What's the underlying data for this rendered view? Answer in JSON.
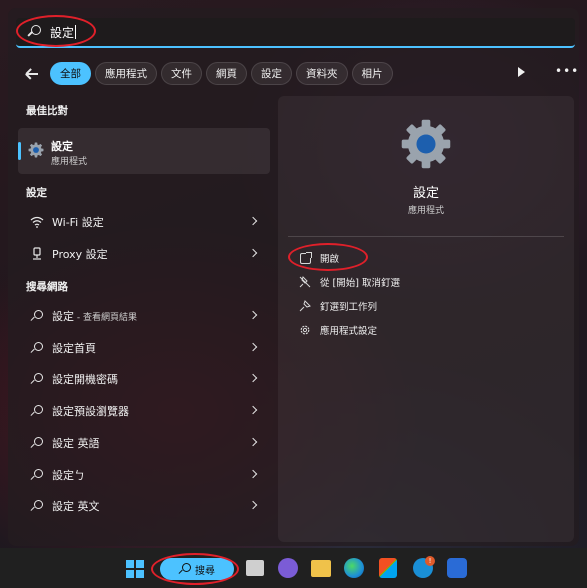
{
  "search": {
    "query": "設定"
  },
  "filters": {
    "chips": [
      "全部",
      "應用程式",
      "文件",
      "網頁",
      "設定",
      "資料夾",
      "相片"
    ],
    "active_index": 0
  },
  "best_match": {
    "heading": "最佳比對",
    "name": "設定",
    "type": "應用程式"
  },
  "settings_section": {
    "heading": "設定",
    "items": [
      {
        "label": "Wi-Fi 設定",
        "icon": "wifi-icon"
      },
      {
        "label": "Proxy 設定",
        "icon": "proxy-icon"
      }
    ]
  },
  "web_section": {
    "heading": "搜尋網路",
    "items": [
      {
        "label": "設定",
        "suffix": " - 查看網頁結果"
      },
      {
        "label": "設定首頁",
        "suffix": ""
      },
      {
        "label": "設定開機密碼",
        "suffix": ""
      },
      {
        "label": "設定預設瀏覽器",
        "suffix": ""
      },
      {
        "label": "設定 英語",
        "suffix": ""
      },
      {
        "label": "設定ㄅ",
        "suffix": ""
      },
      {
        "label": "設定 英文",
        "suffix": ""
      }
    ]
  },
  "detail": {
    "name": "設定",
    "type": "應用程式",
    "actions": [
      {
        "label": "開啟",
        "icon": "open-icon"
      },
      {
        "label": "從 [開始] 取消釘選",
        "icon": "unpin-icon"
      },
      {
        "label": "釘選到工作列",
        "icon": "pin-icon"
      },
      {
        "label": "應用程式設定",
        "icon": "gear-icon"
      }
    ]
  },
  "taskbar": {
    "search_label": "搜尋",
    "badge": "!"
  },
  "colors": {
    "accent": "#4cc2ff",
    "highlight_ring": "#e0202a",
    "panel": "#241c20"
  }
}
